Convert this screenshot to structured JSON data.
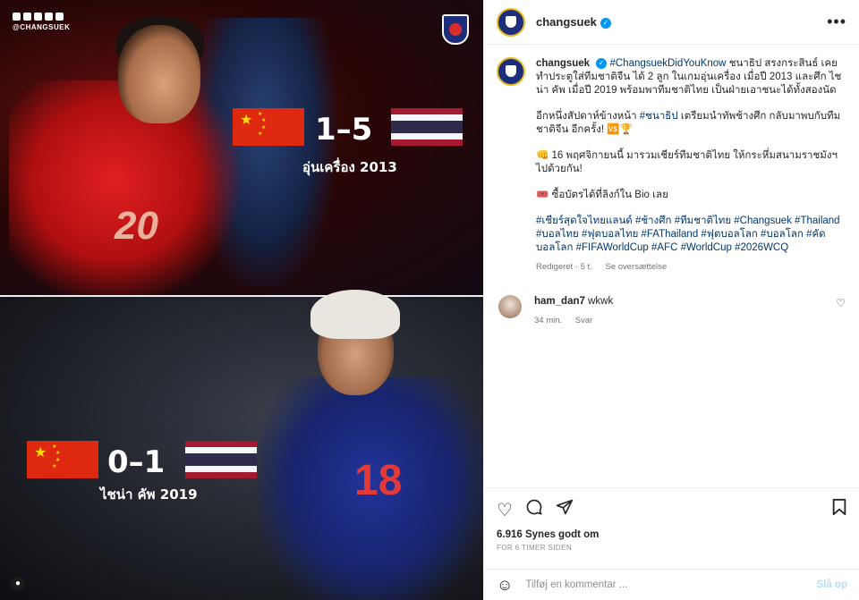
{
  "media": {
    "brand_handle": "@CHANGSUEK",
    "match1": {
      "score": "1–5",
      "caption": "อุ่นเครื่อง 2013",
      "jersey": "20"
    },
    "match2": {
      "score": "0–1",
      "caption": "ไชน่า คัพ 2019",
      "jersey": "18"
    }
  },
  "post": {
    "username": "changsuek",
    "more_icon": "more-options-icon",
    "caption": {
      "username": "changsuek",
      "p1_tag": "#ChangsuekDidYouKnow",
      "p1_text": " ชนาธิป สรงกระสินธ์ เคยทำประตูใส่ทีมชาติจีน ได้ 2 ลูก ในเกมอุ่นเครื่อง เมื่อปี 2013 และศึก ไชน่า คัพ เมื่อปี 2019 พร้อมพาทีมชาติไทย เป็นฝ่ายเอาชนะได้ทั้งสองนัด",
      "p2_pre": "อีกหนึ่งสัปดาห์ข้างหน้า ",
      "p2_tag": "#ชนาธิป",
      "p2_post": " เตรียมนำทัพช้างศึก กลับมาพบกับทีมชาติจีน อีกครั้ง! 🆚🏆",
      "p3": "👊 16 พฤศจิกายนนี้ มารวมเชียร์ทีมชาติไทย ให้กระหึ่มสนามราชมังฯ ไปด้วยกัน!",
      "p4": "🎟️ ซื้อบัตรได้ที่ลิงก์ใน Bio เลย",
      "hashtags": "#เชียร์สุดใจไทยแลนด์ #ช้างศึก #ทีมชาติไทย #Changsuek #Thailand #บอลไทย #ฟุตบอลไทย #FAThailand #ฟุตบอลโลก #บอลโลก #คัดบอลโลก #FIFAWorldCup #AFC #WorldCup #2026WCQ",
      "edited": "Redigeret · 5 t.",
      "translate": "Se oversættelse"
    },
    "comment": {
      "username": "ham_dan7",
      "text": " wkwk",
      "time": "34 min.",
      "reply": "Svar"
    },
    "likes": "6.916 Synes godt om",
    "time_ago": "FOR 6 TIMER SIDEN",
    "add_comment_placeholder": "Tilføj en kommentar ...",
    "post_button": "Slå op"
  }
}
